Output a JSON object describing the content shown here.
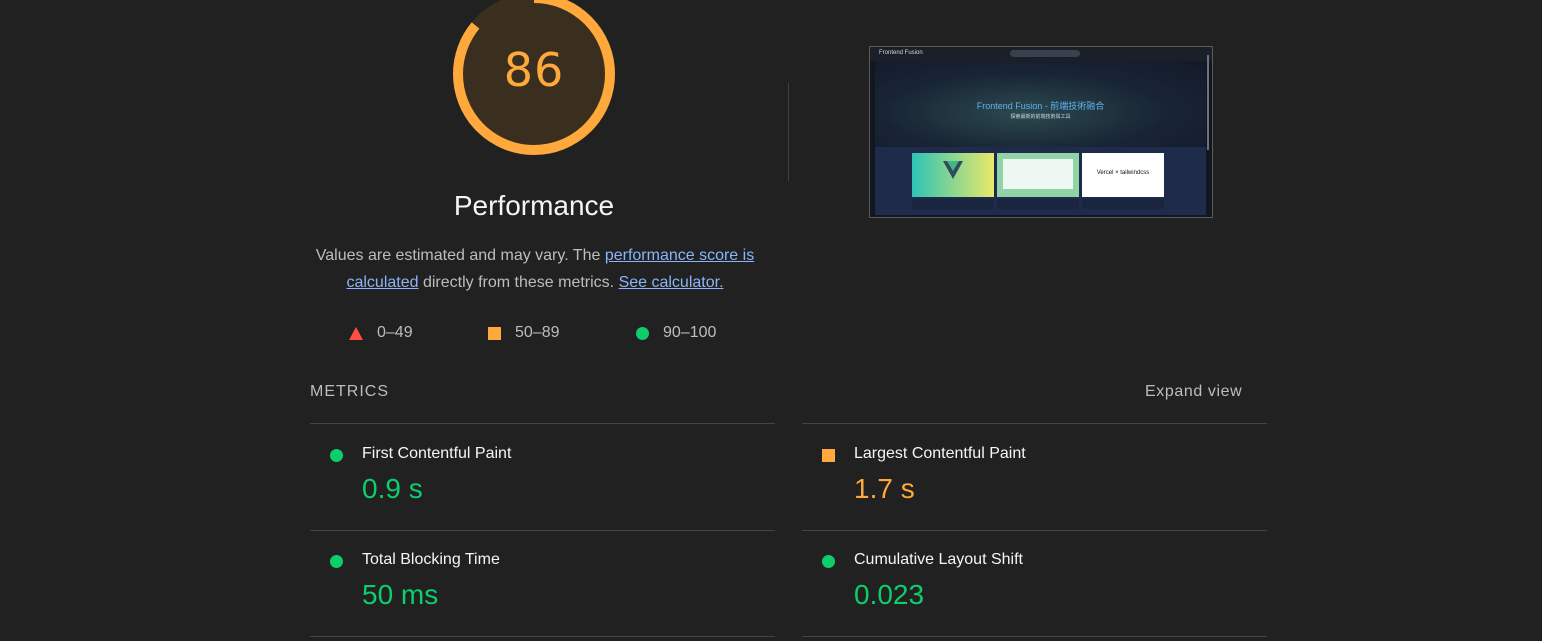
{
  "gauge": {
    "score": "86",
    "score_fraction": 0.86,
    "color": "#ffa93d",
    "title": "Performance"
  },
  "description": {
    "text_before": "Values are estimated and may vary. The ",
    "link1": "performance score is calculated",
    "text_middle": " directly from these metrics. ",
    "link2": "See calculator."
  },
  "legend": [
    {
      "range": "0–49",
      "icon": "fail-triangle-icon",
      "color": "#ff4e42"
    },
    {
      "range": "50–89",
      "icon": "average-square-icon",
      "color": "#ffa93d"
    },
    {
      "range": "90–100",
      "icon": "pass-circle-icon",
      "color": "#0cce6b"
    }
  ],
  "screenshot": {
    "brand": "Frontend Fusion",
    "hero_title": "Frontend Fusion - 前端技術融合",
    "hero_subtitle": "探索最新的前端技術與工具",
    "card3_text": "Vercel × tailwindcss"
  },
  "metrics": {
    "header": "METRICS",
    "expand_label": "Expand view",
    "items": [
      {
        "label": "First Contentful Paint",
        "value": "0.9 s",
        "status": "pass"
      },
      {
        "label": "Largest Contentful Paint",
        "value": "1.7 s",
        "status": "average"
      },
      {
        "label": "Total Blocking Time",
        "value": "50 ms",
        "status": "pass"
      },
      {
        "label": "Cumulative Layout Shift",
        "value": "0.023",
        "status": "pass"
      }
    ]
  },
  "colors": {
    "pass": "#0cce6b",
    "average": "#ffa93d",
    "fail": "#ff4e42",
    "link": "#8ab4f8",
    "background": "#212121"
  }
}
